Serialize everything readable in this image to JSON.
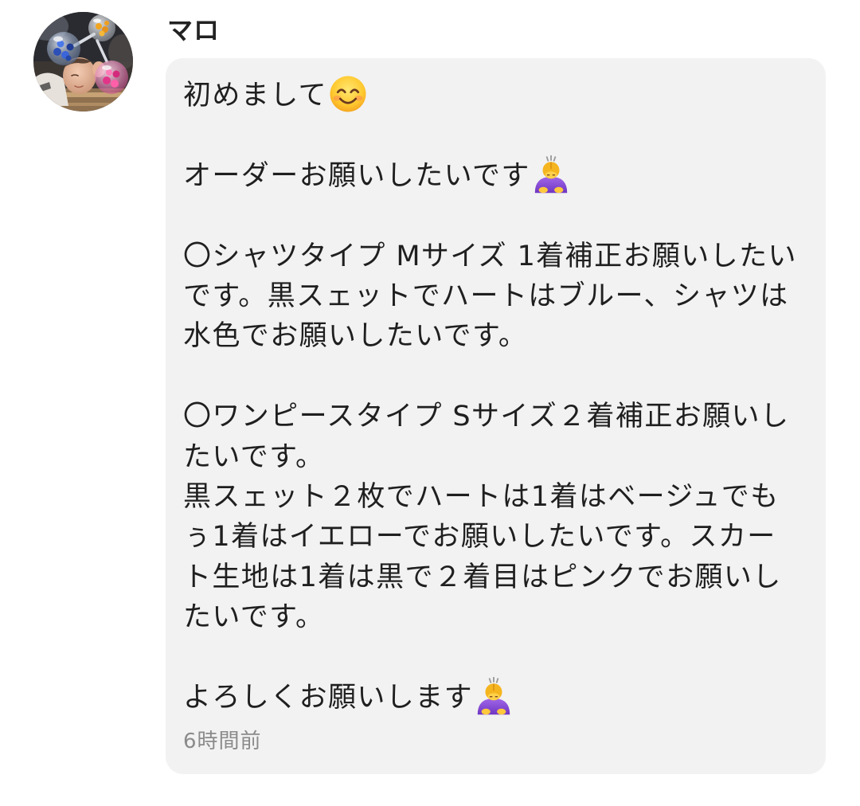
{
  "comment": {
    "author": {
      "name": "マロ",
      "avatar_icon": "avatar-photo"
    },
    "message": {
      "paragraphs": [
        {
          "lines": [
            "初めまして"
          ],
          "trailing_emoji_icon": "smiling-face-icon"
        },
        {
          "lines": [
            "オーダーお願いしたいです"
          ],
          "trailing_emoji_icon": "woman-bowing-icon"
        },
        {
          "lines": [
            "〇シャツタイプ Mサイズ 1着補正お願いしたい",
            "です。黒スェットでハートはブルー、シャツは",
            "水色でお願いしたいです。"
          ]
        },
        {
          "lines": [
            "〇ワンピースタイプ Sサイズ２着補正お願いし",
            "たいです。",
            "黒スェット２枚でハートは1着はベージュでも",
            "ぅ1着はイエローでお願いしたいです。スカー",
            "ト生地は1着は黒で２着目はピンクでお願いし",
            "たいです。"
          ]
        },
        {
          "lines": [
            "よろしくお願いします"
          ],
          "trailing_emoji_icon": "woman-bowing-icon"
        }
      ]
    },
    "timestamp": "6時間前"
  },
  "colors": {
    "page_background": "#ffffff",
    "bubble_background": "#f2f2f2",
    "text": "#1f1f1f",
    "timestamp": "#8b8b8b"
  }
}
